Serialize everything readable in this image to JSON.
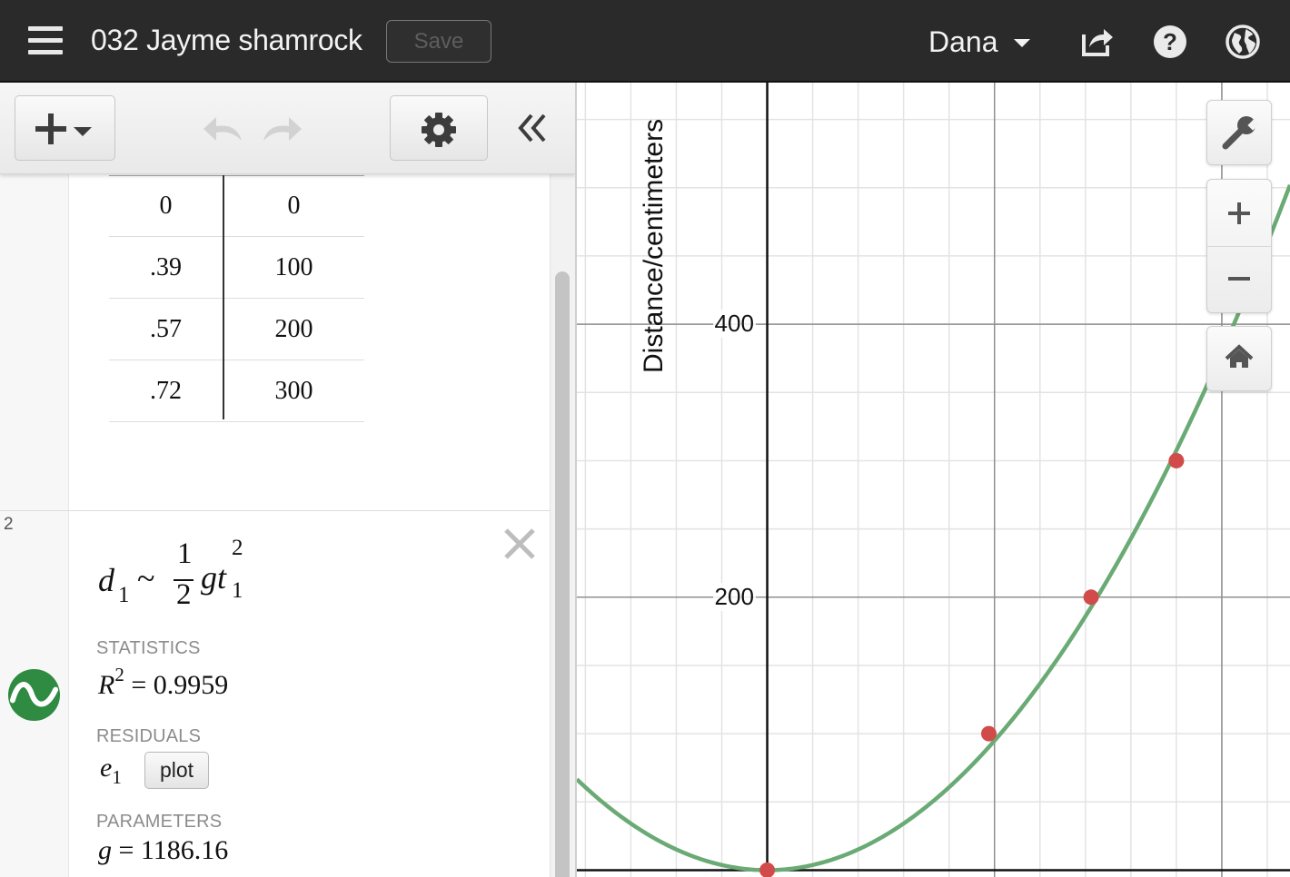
{
  "header": {
    "graph_title": "032 Jayme shamrock",
    "save_label": "Save",
    "user_name": "Dana",
    "icons": [
      "menu-icon",
      "share-icon",
      "help-icon",
      "language-globe-icon"
    ]
  },
  "expression_list": {
    "table": {
      "rows": [
        [
          "0",
          "0"
        ],
        [
          ".39",
          "100"
        ],
        [
          ".57",
          "200"
        ],
        [
          ".72",
          "300"
        ]
      ]
    },
    "regression": {
      "item_number": "2",
      "expression": {
        "lhs": "d",
        "lhs_sub": "1",
        "relation": "~",
        "frac_num": "1",
        "frac_den": "2",
        "var_g": "g",
        "var_t": "t",
        "t_sup": "2",
        "t_sub": "1"
      },
      "statistics_label": "STATISTICS",
      "r2": {
        "symbol": "R",
        "sup": "2",
        "value": "= 0.9959"
      },
      "residuals_label": "RESIDUALS",
      "residual": {
        "symbol": "e",
        "sub": "1"
      },
      "plot_label": "plot",
      "parameters_label": "PARAMETERS",
      "parameter": {
        "symbol": "g",
        "value": "= 1186.16"
      }
    }
  },
  "graph": {
    "y_axis_title": "Distance/centimeters",
    "y_tick_labels": [
      "400",
      "200"
    ],
    "colors": {
      "curve": "#6aaa74",
      "points": "#d24b4b",
      "grid_minor": "#e3e3e3",
      "grid_major": "#8f8f8f"
    },
    "model": {
      "type": "quadratic",
      "g": 1186.16,
      "expression": "d = 0.5 * g * t^2"
    },
    "data_points": [
      {
        "t": 0,
        "d": 0
      },
      {
        "t": 0.39,
        "d": 100
      },
      {
        "t": 0.57,
        "d": 200
      },
      {
        "t": 0.72,
        "d": 300
      }
    ],
    "visible_range": {
      "x": [
        -0.335,
        0.92
      ],
      "y": [
        -5,
        577
      ]
    },
    "major_gridlines": {
      "x": [
        0,
        0.4,
        0.8
      ],
      "y": [
        200,
        400
      ]
    },
    "minor_step": {
      "x": 0.08,
      "y": 50
    }
  }
}
